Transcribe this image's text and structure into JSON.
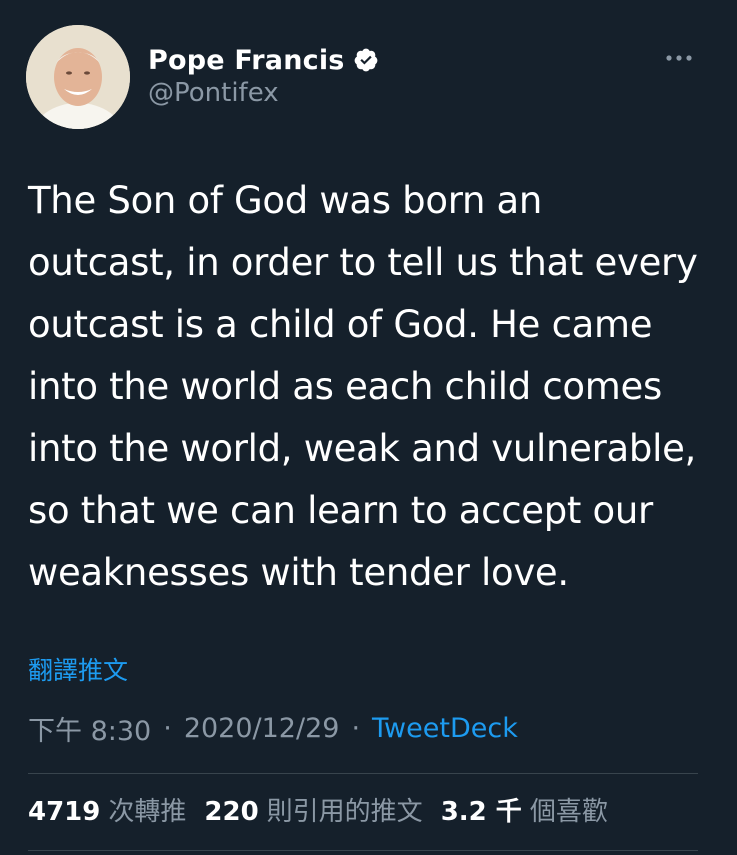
{
  "author": {
    "display_name": "Pope Francis",
    "handle": "@Pontifex",
    "verified_icon": "verified-badge-icon",
    "avatar_icon": "avatar-photo"
  },
  "menu": {
    "more_icon": "more-options-icon"
  },
  "tweet": {
    "text": "The Son of God was born an\noutcast, in order to tell us that every\noutcast is a child of God.  He came\ninto the world as each child comes\ninto the world, weak and vulnerable,\nso that we can learn to accept our\nweaknesses with tender love."
  },
  "translate_label": "翻譯推文",
  "meta": {
    "time": "下午 8:30",
    "separator": "·",
    "date": "2020/12/29",
    "source": "TweetDeck"
  },
  "stats": {
    "retweets_count": "4719",
    "retweets_label": "次轉推",
    "quotes_count": "220",
    "quotes_label": "則引用的推文",
    "likes_count": "3.2 千",
    "likes_label": "個喜歡"
  },
  "colors": {
    "background": "#15202b",
    "text": "#ffffff",
    "secondary": "#8b98a5",
    "accent": "#1d9bf0",
    "divider": "#38444d"
  }
}
